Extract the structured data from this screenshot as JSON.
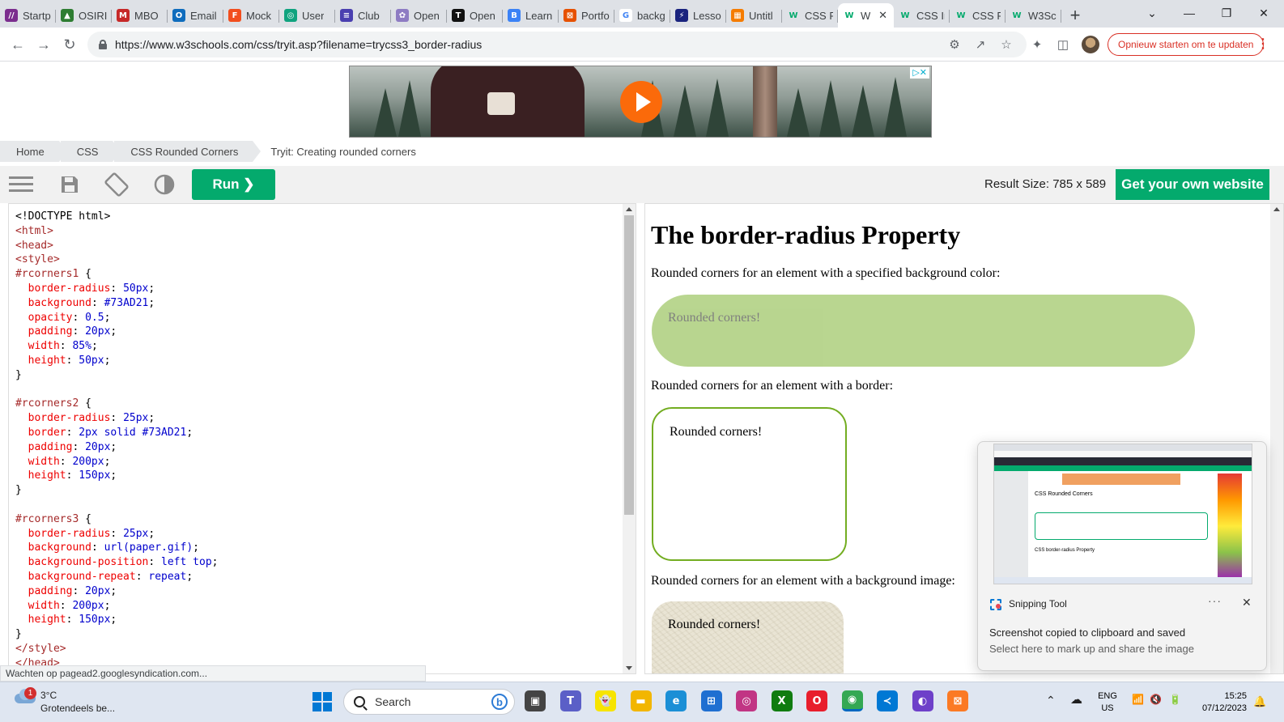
{
  "browser": {
    "tabs": [
      {
        "label": "Startp",
        "color": "#7b2d8e",
        "glyph": "//"
      },
      {
        "label": "OSIRI",
        "color": "#2e7d32",
        "glyph": "▲"
      },
      {
        "label": "MBO",
        "color": "#c62828",
        "glyph": "M"
      },
      {
        "label": "Email",
        "color": "#0f6cbd",
        "glyph": "O"
      },
      {
        "label": "Mock",
        "color": "#f24e1e",
        "glyph": "F"
      },
      {
        "label": "User",
        "color": "#10a37f",
        "glyph": "◎"
      },
      {
        "label": "Club",
        "color": "#4a3fb0",
        "glyph": "≡"
      },
      {
        "label": "Open",
        "color": "#8e7cc3",
        "glyph": "✿"
      },
      {
        "label": "Open",
        "color": "#111111",
        "glyph": "T"
      },
      {
        "label": "Learn",
        "color": "#3b82f6",
        "glyph": "B"
      },
      {
        "label": "Portfo",
        "color": "#e65100",
        "glyph": "⊠"
      },
      {
        "label": "backg",
        "color": "#ffffff",
        "glyph": "G"
      },
      {
        "label": "Lesso",
        "color": "#1a237e",
        "glyph": "⚡"
      },
      {
        "label": "Untitl",
        "color": "#f57c00",
        "glyph": "▦"
      },
      {
        "label": "CSS R",
        "color": "#04aa6d",
        "glyph": "W"
      },
      {
        "label": "W",
        "color": "#04aa6d",
        "glyph": "W"
      },
      {
        "label": "CSS Ir",
        "color": "#04aa6d",
        "glyph": "W"
      },
      {
        "label": "CSS R",
        "color": "#04aa6d",
        "glyph": "W"
      },
      {
        "label": "W3Sc",
        "color": "#04aa6d",
        "glyph": "W"
      }
    ],
    "active_tab_close": "✕",
    "new_tab": "+",
    "window_controls": [
      "⌄",
      "—",
      "❐",
      "✕"
    ],
    "url": "https://www.w3schools.com/css/tryit.asp?filename=trycss3_border-radius",
    "update_button": "Opnieuw starten om te updaten",
    "status_text": "Wachten op pagead2.googlesyndication.com..."
  },
  "ad": {
    "adchoices": "▷✕"
  },
  "breadcrumb": [
    "Home",
    "CSS",
    "CSS Rounded Corners",
    "Tryit: Creating rounded corners"
  ],
  "toolbar": {
    "run_label": "Run ❯",
    "result_size": "Result Size: 785 x 589",
    "own_website": "Get your own website"
  },
  "code_lines": [
    [
      [
        "t",
        "<!DOCTYPE html>"
      ]
    ],
    [
      [
        "tag",
        "<html>"
      ]
    ],
    [
      [
        "tag",
        "<head>"
      ]
    ],
    [
      [
        "tag",
        "<style>"
      ]
    ],
    [
      [
        "sel",
        "#rcorners1 "
      ],
      [
        "t",
        "{"
      ]
    ],
    [
      [
        "t",
        "  "
      ],
      [
        "prop",
        "border-radius"
      ],
      [
        "t",
        ": "
      ],
      [
        "val",
        "50px"
      ],
      [
        "t",
        ";"
      ]
    ],
    [
      [
        "t",
        "  "
      ],
      [
        "prop",
        "background"
      ],
      [
        "t",
        ": "
      ],
      [
        "val",
        "#73AD21"
      ],
      [
        "t",
        ";"
      ]
    ],
    [
      [
        "t",
        "  "
      ],
      [
        "prop",
        "opacity"
      ],
      [
        "t",
        ": "
      ],
      [
        "val",
        "0.5"
      ],
      [
        "t",
        ";"
      ]
    ],
    [
      [
        "t",
        "  "
      ],
      [
        "prop",
        "padding"
      ],
      [
        "t",
        ": "
      ],
      [
        "val",
        "20px"
      ],
      [
        "t",
        ";"
      ]
    ],
    [
      [
        "t",
        "  "
      ],
      [
        "prop",
        "width"
      ],
      [
        "t",
        ": "
      ],
      [
        "val",
        "85%"
      ],
      [
        "t",
        ";"
      ]
    ],
    [
      [
        "t",
        "  "
      ],
      [
        "prop",
        "height"
      ],
      [
        "t",
        ": "
      ],
      [
        "val",
        "50px"
      ],
      [
        "t",
        ";"
      ]
    ],
    [
      [
        "t",
        "}"
      ]
    ],
    [
      [
        "t",
        ""
      ]
    ],
    [
      [
        "sel",
        "#rcorners2 "
      ],
      [
        "t",
        "{"
      ]
    ],
    [
      [
        "t",
        "  "
      ],
      [
        "prop",
        "border-radius"
      ],
      [
        "t",
        ": "
      ],
      [
        "val",
        "25px"
      ],
      [
        "t",
        ";"
      ]
    ],
    [
      [
        "t",
        "  "
      ],
      [
        "prop",
        "border"
      ],
      [
        "t",
        ": "
      ],
      [
        "val",
        "2px solid #73AD21"
      ],
      [
        "t",
        ";"
      ]
    ],
    [
      [
        "t",
        "  "
      ],
      [
        "prop",
        "padding"
      ],
      [
        "t",
        ": "
      ],
      [
        "val",
        "20px"
      ],
      [
        "t",
        ";"
      ]
    ],
    [
      [
        "t",
        "  "
      ],
      [
        "prop",
        "width"
      ],
      [
        "t",
        ": "
      ],
      [
        "val",
        "200px"
      ],
      [
        "t",
        ";"
      ]
    ],
    [
      [
        "t",
        "  "
      ],
      [
        "prop",
        "height"
      ],
      [
        "t",
        ": "
      ],
      [
        "val",
        "150px"
      ],
      [
        "t",
        ";"
      ]
    ],
    [
      [
        "t",
        "}"
      ]
    ],
    [
      [
        "t",
        ""
      ]
    ],
    [
      [
        "sel",
        "#rcorners3 "
      ],
      [
        "t",
        "{"
      ]
    ],
    [
      [
        "t",
        "  "
      ],
      [
        "prop",
        "border-radius"
      ],
      [
        "t",
        ": "
      ],
      [
        "val",
        "25px"
      ],
      [
        "t",
        ";"
      ]
    ],
    [
      [
        "t",
        "  "
      ],
      [
        "prop",
        "background"
      ],
      [
        "t",
        ": "
      ],
      [
        "val",
        "url(paper.gif)"
      ],
      [
        "t",
        ";"
      ]
    ],
    [
      [
        "t",
        "  "
      ],
      [
        "prop",
        "background-position"
      ],
      [
        "t",
        ": "
      ],
      [
        "val",
        "left top"
      ],
      [
        "t",
        ";"
      ]
    ],
    [
      [
        "t",
        "  "
      ],
      [
        "prop",
        "background-repeat"
      ],
      [
        "t",
        ": "
      ],
      [
        "val",
        "repeat"
      ],
      [
        "t",
        ";"
      ]
    ],
    [
      [
        "t",
        "  "
      ],
      [
        "prop",
        "padding"
      ],
      [
        "t",
        ": "
      ],
      [
        "val",
        "20px"
      ],
      [
        "t",
        ";"
      ]
    ],
    [
      [
        "t",
        "  "
      ],
      [
        "prop",
        "width"
      ],
      [
        "t",
        ": "
      ],
      [
        "val",
        "200px"
      ],
      [
        "t",
        ";"
      ]
    ],
    [
      [
        "t",
        "  "
      ],
      [
        "prop",
        "height"
      ],
      [
        "t",
        ": "
      ],
      [
        "val",
        "150px"
      ],
      [
        "t",
        ";"
      ]
    ],
    [
      [
        "t",
        "}"
      ]
    ],
    [
      [
        "tag",
        "</style>"
      ]
    ],
    [
      [
        "tag",
        "</head>"
      ]
    ]
  ],
  "result": {
    "title": "The border-radius Property",
    "p1": "Rounded corners for an element with a specified background color:",
    "box1": "Rounded corners!",
    "p2": "Rounded corners for an element with a border:",
    "box2": "Rounded corners!",
    "p3": "Rounded corners for an element with a background image:",
    "box3": "Rounded corners!"
  },
  "snipping_toast": {
    "app": "Snipping Tool",
    "more": "···",
    "close": "✕",
    "message": "Screenshot copied to clipboard and saved",
    "sub": "Select here to mark up and share the image",
    "thumb_heading": "CSS Rounded Corners",
    "thumb_sub": "CSS border-radius Property"
  },
  "taskbar": {
    "weather_badge": "1",
    "temperature": "3°C",
    "weather_desc": "Grotendeels be...",
    "search_placeholder": "Search",
    "bing": "b",
    "lang_line1": "ENG",
    "lang_line2": "US",
    "time": "15:25",
    "date": "07/12/2023",
    "tray_icons": [
      "⌃",
      "☁",
      "📶",
      "🔇",
      "🔋"
    ],
    "apps": [
      {
        "name": "task-view",
        "color": "#444",
        "glyph": "▣"
      },
      {
        "name": "teams",
        "color": "#5b5fc7",
        "glyph": "T"
      },
      {
        "name": "snapchat",
        "color": "#f7e400",
        "glyph": "👻"
      },
      {
        "name": "file-explorer",
        "color": "#f2b600",
        "glyph": "▬"
      },
      {
        "name": "edge",
        "color": "#1b8fd6",
        "glyph": "e"
      },
      {
        "name": "store",
        "color": "#1f6fd1",
        "glyph": "⊞"
      },
      {
        "name": "instagram",
        "color": "#c13584",
        "glyph": "◎"
      },
      {
        "name": "xbox",
        "color": "#107c10",
        "glyph": "X"
      },
      {
        "name": "opera",
        "color": "#e81e2c",
        "glyph": "O"
      },
      {
        "name": "chrome",
        "color": "#34a853",
        "glyph": "◉"
      },
      {
        "name": "vscode",
        "color": "#0078d4",
        "glyph": "≺"
      },
      {
        "name": "github-desktop",
        "color": "#6e40c9",
        "glyph": "◐"
      },
      {
        "name": "xampp",
        "color": "#fb7a24",
        "glyph": "⊠"
      }
    ]
  }
}
